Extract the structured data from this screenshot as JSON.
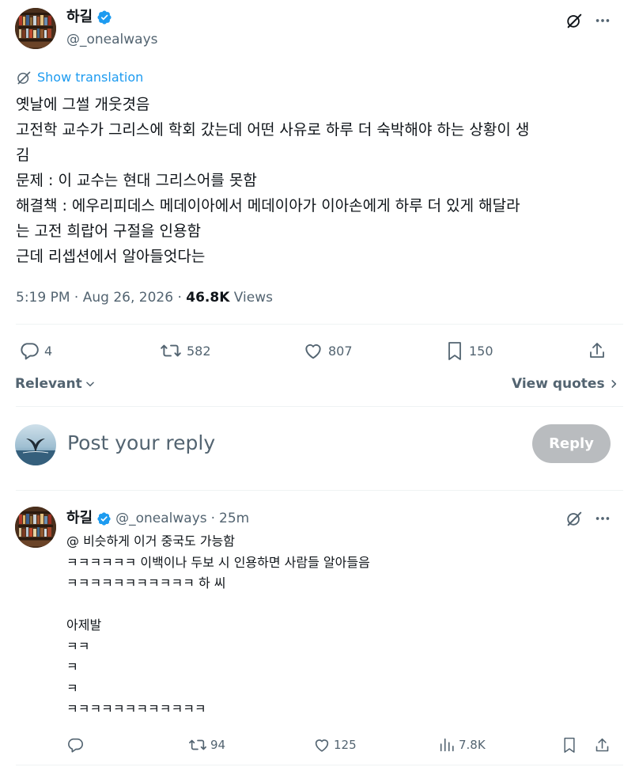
{
  "tweet": {
    "author_name": "하길",
    "author_handle": "@_onealways",
    "show_translation": "Show translation",
    "lines": [
      "옛날에 그썰 개웃겻음",
      "고전학 교수가 그리스에 학회 갔는데 어떤 사유로 하루 더 숙박해야 하는 상황이 생",
      "김",
      "문제 : 이 교수는 현대 그리스어를 못함",
      "해결책 : 에우리피데스 메데이아에서 메데이아가 이아손에게 하루 더 있게 해달라",
      "는 고전 희랍어 구절을 인용함",
      "근데 리셉션에서 알아들엇다는"
    ],
    "time": "5:19 PM",
    "date": "Aug 26, 2026",
    "views_count": "46.8K",
    "views_label": "Views",
    "replies": "4",
    "reposts": "582",
    "likes": "807",
    "bookmarks": "150"
  },
  "sort": {
    "label": "Relevant",
    "view_quotes": "View quotes"
  },
  "composer": {
    "placeholder": "Post your reply",
    "button": "Reply"
  },
  "reply": {
    "author_name": "하길",
    "author_handle": "@_onealways",
    "time": "25m",
    "lines": [
      "@ 비슷하게 이거 중국도 가능함",
      "ㅋㅋㅋㅋㅋㅋ 이백이나 두보 시 인용하면 사람들 알아들음",
      "ㅋㅋㅋㅋㅋㅋㅋㅋㅋㅋㅋ 하 씨",
      "",
      "아제발",
      "ㅋㅋ",
      "ㅋ",
      "ㅋ",
      "ㅋㅋㅋㅋㅋㅋㅋㅋㅋㅋㅋㅋ"
    ],
    "reposts": "94",
    "likes": "125",
    "views": "7.8K"
  },
  "colors": {
    "accent": "#1d9bf0",
    "muted": "#536471",
    "text": "#0f1419",
    "divider": "#eff3f4",
    "reply_button_disabled": "#b9bcbf"
  }
}
